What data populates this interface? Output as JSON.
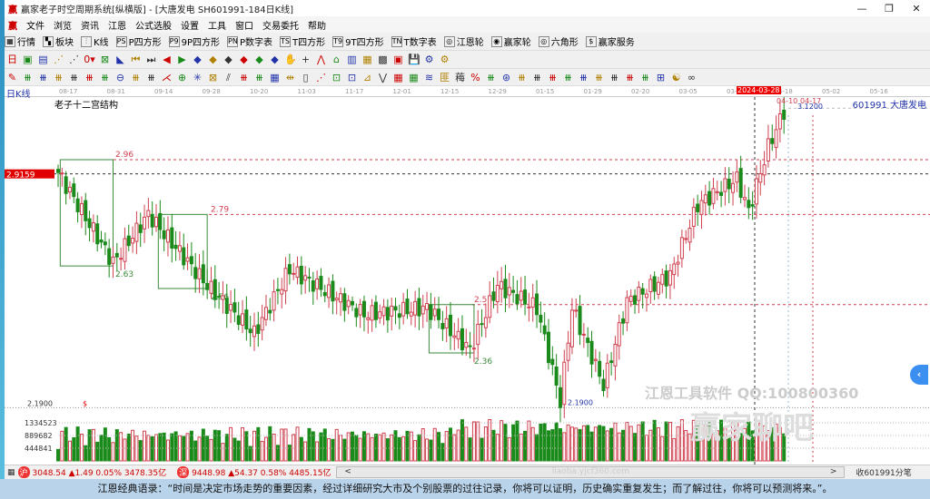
{
  "window": {
    "title": "赢家老子时空周期系统[纵横版] - [大唐发电  SH601991-184日K线]",
    "logo": "赢",
    "controls": [
      "—",
      "❐",
      "✕"
    ]
  },
  "menu": [
    "文件",
    "浏览",
    "资讯",
    "江恩",
    "公式选股",
    "设置",
    "工具",
    "窗口",
    "交易委托",
    "帮助"
  ],
  "toolbar1": [
    {
      "icon": "▦",
      "label": "行情"
    },
    {
      "icon": "▚",
      "label": "板块"
    },
    {
      "icon": "⫶",
      "label": "K线"
    },
    {
      "icon": "PS",
      "label": "P四方形"
    },
    {
      "icon": "P9",
      "label": "9P四方形"
    },
    {
      "icon": "PN",
      "label": "P数字表"
    },
    {
      "icon": "TS",
      "label": "T四方形"
    },
    {
      "icon": "T9",
      "label": "9T四方形"
    },
    {
      "icon": "TN",
      "label": "T数字表"
    },
    {
      "icon": "◎",
      "label": "江恩轮"
    },
    {
      "icon": "◉",
      "label": "赢家轮"
    },
    {
      "icon": "◎",
      "label": "六角形"
    },
    {
      "icon": "$",
      "label": "赢家服务"
    }
  ],
  "toolbar2": [
    "日▾",
    "▣",
    "▤",
    "⋰",
    "⋰",
    "0▾",
    "⊠",
    "◣",
    "⏮",
    "⏭",
    "◀",
    "▶",
    "◆",
    "◆",
    "◆",
    "◆",
    "◆",
    "◆",
    "✋",
    "+",
    "⋀",
    "⌂",
    "▥",
    "▦",
    "▩",
    "▣",
    "💾",
    "⚙",
    "⚙"
  ],
  "toolbar3": [
    "✎",
    "⧻",
    "⧻",
    "⧻",
    "⧻",
    "⧻",
    "⧻",
    "⊖",
    "⧻",
    "⧻",
    "⋌",
    "⊕",
    "✳",
    "⊠",
    "⫽",
    "⧻",
    "⧻",
    "▦",
    "⇹",
    "▯",
    "⋰",
    "⊡",
    "⊡",
    "⊿",
    "⋁",
    "▦",
    "▦",
    "≋",
    "匪",
    "䔦",
    "%",
    "⧻",
    "⊛",
    "⧻",
    "⧻",
    "⧻",
    "⧻",
    "⧻",
    "⧻",
    "⧻",
    "⧻",
    "⧻",
    "⊞",
    "☯",
    "∞"
  ],
  "period_label": "日K线",
  "date_axis": [
    "08-17",
    "08-31",
    "09-14",
    "09-28",
    "10-20",
    "11-03",
    "11-17",
    "12-01",
    "12-15",
    "12-29",
    "01-15",
    "01-29",
    "02-20",
    "03-05",
    "03-19",
    "04-18",
    "05-02",
    "05-16"
  ],
  "cursor_date": "2024-03-28",
  "indicator_title": "老子十二宫结构",
  "stock_label": "601991  大唐发电",
  "price_tag": "2.9159",
  "watermark": {
    "text": "江恩工具软件  QQ:100800360",
    "brand": "赢家聊吧",
    "url": "liaoba.yjcf360.com"
  },
  "chart_data": {
    "type": "candlestick",
    "candle_count": 186,
    "anchors": [
      [
        0,
        2.92
      ],
      [
        14,
        2.64
      ],
      [
        23,
        2.79
      ],
      [
        38,
        2.57
      ],
      [
        50,
        2.42
      ],
      [
        59,
        2.62
      ],
      [
        78,
        2.48
      ],
      [
        94,
        2.5
      ],
      [
        105,
        2.37
      ],
      [
        112,
        2.57
      ],
      [
        122,
        2.5
      ],
      [
        128,
        2.21
      ],
      [
        131,
        2.5
      ],
      [
        139,
        2.26
      ],
      [
        145,
        2.52
      ],
      [
        156,
        2.6
      ],
      [
        163,
        2.82
      ],
      [
        173,
        2.9
      ],
      [
        176,
        2.8
      ],
      [
        181,
        3.0
      ],
      [
        185,
        3.11
      ]
    ],
    "levels": [
      {
        "label": "2.96",
        "value": 2.96,
        "color": "#d04050"
      },
      {
        "label": "2.79",
        "value": 2.79,
        "color": "#d04050"
      },
      {
        "label": "2.51",
        "value": 2.51,
        "color": "#d04050"
      },
      {
        "label": "2.63",
        "value": 2.63,
        "color": "#3a8a3a"
      },
      {
        "label": "2.56",
        "value": 2.56,
        "color": "#3a8a3a"
      },
      {
        "label": "2.36",
        "value": 2.36,
        "color": "#3a8a3a"
      }
    ],
    "boxes": [
      {
        "from": 1,
        "to": 14,
        "high": 2.96,
        "low": 2.63
      },
      {
        "from": 26,
        "to": 38,
        "high": 2.79,
        "low": 2.56
      },
      {
        "from": 95,
        "to": 106,
        "high": 2.51,
        "low": 2.36
      }
    ],
    "low_label": "2.1900",
    "high_label": "04-10",
    "high_value_label": "3.1200",
    "end_date_label": "04-17",
    "ylabel_min": "2.1900",
    "ylabel_dollar": "$",
    "volume_ticks": [
      "1334523",
      "889682",
      "444841"
    ],
    "volume_tick_values": [
      1334523,
      889682,
      444841
    ]
  },
  "status": {
    "sh": "3048.54 ▲1.49 0.05% 3478.35亿",
    "sz": "9448.98 ▲54.37 0.58% 4485.15亿",
    "right": "收601991分笔",
    "scroll_left": "<",
    "scroll_right": ">"
  },
  "quote": "江恩经典语录：“时间是决定市场走势的重要因素，经过详细研究大市及个别股票的过往记录，你将可以证明，历史确实重复发生；而了解过往，你将可以预测将来。”。",
  "colors": {
    "up": "#d04050",
    "down": "#1a8a1a",
    "tag": "#e00000"
  }
}
